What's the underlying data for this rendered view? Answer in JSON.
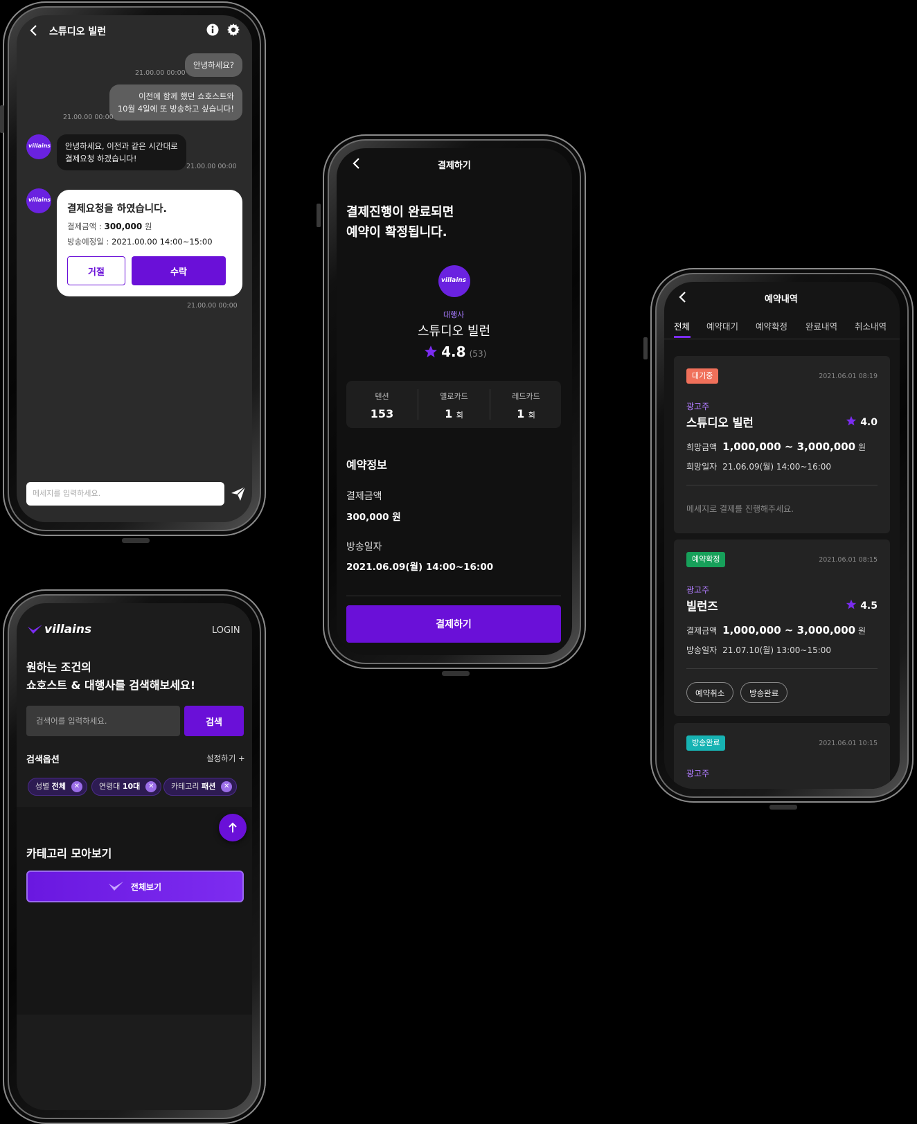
{
  "chat": {
    "title": "스튜디오 빌런",
    "messages_me": [
      {
        "text": "안녕하세요?",
        "time": "21.00.00 00:00"
      },
      {
        "line1": "이전에 함께 했던 쇼호스트와",
        "line2": "10월 4일에 또 방송하고 싶습니다!",
        "time": "21.00.00 00:00"
      }
    ],
    "message_other": {
      "line1": "안녕하세요, 이전과 같은 시간대로",
      "line2": "결제요청 하겠습니다!",
      "time": "21.00.00 00:00"
    },
    "avatar_text": "villains",
    "payment_request": {
      "title": "결제요청을 하였습니다.",
      "amount_label": "결제금액 :",
      "amount_value": "300,000",
      "amount_unit": "원",
      "date_label": "방송예정일 :",
      "date_value": "2021.00.00 14:00~15:00",
      "reject_label": "거절",
      "accept_label": "수락",
      "time": "21.00.00 00:00"
    },
    "input_placeholder": "메세지를 입력하세요."
  },
  "payment": {
    "header_title": "결제하기",
    "headline_line1": "결제진행이 완료되면",
    "headline_line2": "예약이 확정됩니다.",
    "logo_text": "villains",
    "agency_label": "대행사",
    "agency_name": "스튜디오 빌런",
    "rating": "4.8",
    "rating_count": "(53)",
    "stats": [
      {
        "label": "텐션",
        "value": "153",
        "unit": ""
      },
      {
        "label": "옐로카드",
        "value": "1",
        "unit": "회"
      },
      {
        "label": "레드카드",
        "value": "1",
        "unit": "회"
      }
    ],
    "section_title": "예약정보",
    "amount_label": "결제금액",
    "amount_value": "300,000 원",
    "date_label": "방송일자",
    "date_value": "2021.06.09(월) 14:00~16:00",
    "pay_button": "결제하기"
  },
  "reservations": {
    "header_title": "예약내역",
    "tabs": [
      "전체",
      "예약대기",
      "예약확정",
      "완료내역",
      "취소내역"
    ],
    "cards": [
      {
        "badge": "대기중",
        "badge_color": "#f0705a",
        "date": "2021.06.01 08:19",
        "category": "광고주",
        "name": "스튜디오 빌런",
        "rating": "4.0",
        "price_label": "희망금액",
        "price": "1,000,000 ~ 3,000,000",
        "unit": "원",
        "date_label": "희망일자",
        "date_value": "21.06.09(월) 14:00~16:00",
        "note": "메세지로 결제를 진행해주세요."
      },
      {
        "badge": "예약확정",
        "badge_color": "#17a05a",
        "date": "2021.06.01 08:15",
        "category": "광고주",
        "name": "빌런즈",
        "rating": "4.5",
        "price_label": "결제금액",
        "price": "1,000,000 ~ 3,000,000",
        "unit": "원",
        "date_label": "방송일자",
        "date_value": "21.07.10(월) 13:00~15:00",
        "actions": [
          "예약취소",
          "방송완료"
        ]
      },
      {
        "badge": "방송완료",
        "badge_color": "#17b3b3",
        "date": "2021.06.01 10:15",
        "category": "광고주"
      }
    ]
  },
  "search": {
    "logo": "villains",
    "login": "LOGIN",
    "headline_line1": "원하는 조건의",
    "headline_line2": "쇼호스트 & 대행사를 검색해보세요!",
    "input_placeholder": "검색어를 입력하세요.",
    "search_button": "검색",
    "options_title": "검색옵션",
    "options_link": "설정하기 +",
    "chips": [
      {
        "label": "성별",
        "value": "전체"
      },
      {
        "label": "연령대",
        "value": "10대"
      },
      {
        "label": "카테고리",
        "value": "패션"
      }
    ],
    "category_title": "카테고리 모아보기",
    "all_button": "전체보기"
  },
  "colors": {
    "accent": "#6a10d8",
    "star": "#7b2cf0"
  }
}
